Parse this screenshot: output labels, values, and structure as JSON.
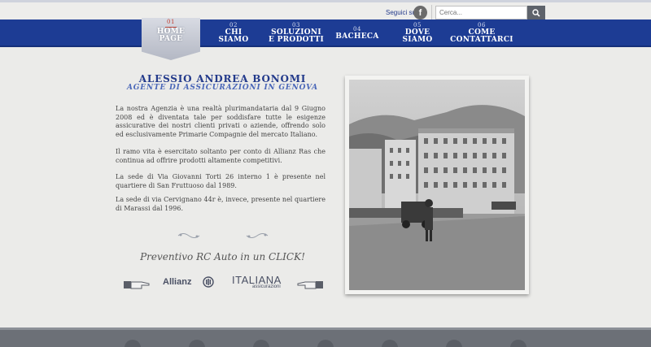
{
  "header": {
    "seguici_label": "Seguici su",
    "facebook_icon_glyph": "f",
    "search": {
      "placeholder": "Cerca...",
      "value": "Cerca..."
    }
  },
  "nav": {
    "items": [
      {
        "num": "01",
        "label": "HOME PAGE",
        "active": true
      },
      {
        "num": "02",
        "label": "CHI SIAMO"
      },
      {
        "num": "03",
        "label": "SOLUZIONI E PRODOTTI"
      },
      {
        "num": "04",
        "label": "BACHECA"
      },
      {
        "num": "05",
        "label": "DOVE SIAMO"
      },
      {
        "num": "06",
        "label": "COME CONTATTARCI"
      }
    ]
  },
  "main": {
    "title": "ALESSIO ANDREA BONOMI",
    "subtitle": "AGENTE DI ASSICURAZIONI IN GENOVA",
    "paragraphs": [
      "La nostra Agenzia è una realtà plurimandataria dal 9 Giugno 2008 ed è diventata tale per soddisfare tutte le esigenze assicurative dei nostri clienti privati o aziende, offrendo solo ed esclusivamente Primarie Compagnie del mercato Italiano.",
      "Il ramo vita è esercitato soltanto per conto di Allianz Ras che continua ad offrire prodotti altamente competitivi.",
      "La sede di Via Giovanni Torti 26 interno 1 è presente nel quartiere di San Fruttuoso dal 1989.",
      "La sede di via Cervignano 44r è, invece, presente nel quartiere di Marassi dal 1996."
    ],
    "cta": "Preventivo RC Auto in un CLICK!",
    "logos": {
      "allianz": "Allianz",
      "italiana": "ITALIANA",
      "italiana_sub": "assicurazioni"
    }
  },
  "colors": {
    "nav_blue": "#1d3c94",
    "title_blue": "#233a8b",
    "background": "#ebebe9",
    "footer": "#6c7077"
  },
  "icons": [
    "facebook-icon",
    "search-icon",
    "ornament-icon",
    "pointing-hand-icon"
  ]
}
